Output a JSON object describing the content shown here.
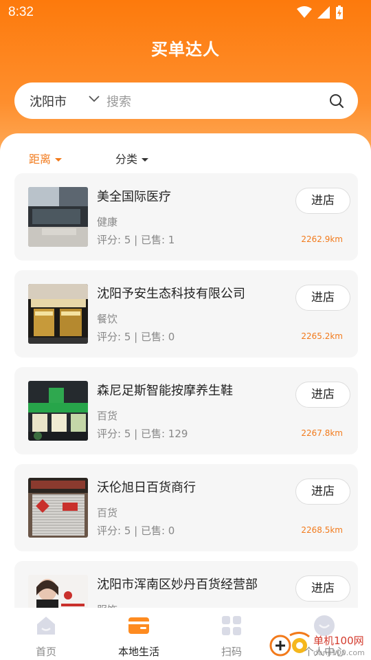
{
  "status_bar": {
    "time": "8:32"
  },
  "header": {
    "title": "买单达人"
  },
  "search": {
    "city": "沈阳市",
    "placeholder": "搜索"
  },
  "filters": {
    "distance": "距离",
    "category": "分类"
  },
  "shops": [
    {
      "name": "美全国际医疗",
      "category": "健康",
      "stats": "评分: 5 | 已售: 1",
      "distance": "2262.9km",
      "button": "进店"
    },
    {
      "name": "沈阳予安生态科技有限公司",
      "category": "餐饮",
      "stats": "评分: 5 | 已售: 0",
      "distance": "2265.2km",
      "button": "进店"
    },
    {
      "name": "森尼足斯智能按摩养生鞋",
      "category": "百货",
      "stats": "评分: 5 | 已售: 129",
      "distance": "2267.8km",
      "button": "进店"
    },
    {
      "name": "沃伦旭日百货商行",
      "category": "百货",
      "stats": "评分: 5 | 已售: 0",
      "distance": "2268.5km",
      "button": "进店"
    },
    {
      "name": "沈阳市浑南区妙丹百货经营部",
      "category": "服饰",
      "stats": "",
      "distance": "",
      "button": "进店"
    }
  ],
  "tabs": [
    {
      "label": "首页",
      "icon": "home-icon"
    },
    {
      "label": "本地生活",
      "icon": "wallet-icon"
    },
    {
      "label": "扫码",
      "icon": "grid-icon"
    },
    {
      "label": "个人中心",
      "icon": "avatar-icon"
    }
  ],
  "watermark": {
    "brand": "单机100网",
    "url": "danji100.com"
  },
  "colors": {
    "accent": "#f27a1b",
    "header": "#fd7a0c"
  }
}
